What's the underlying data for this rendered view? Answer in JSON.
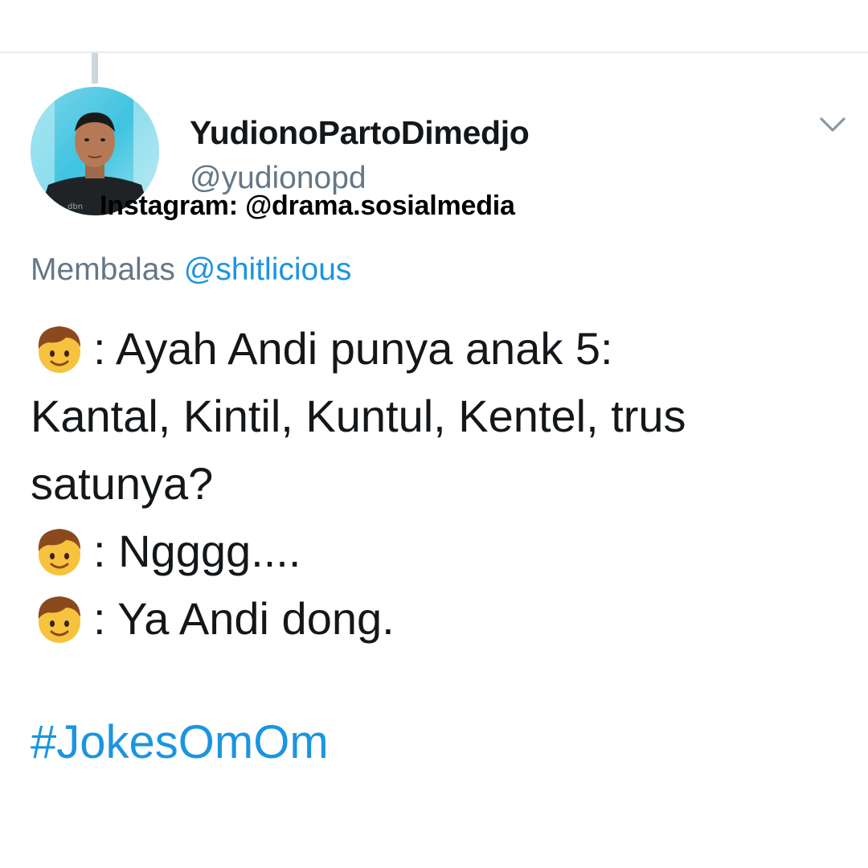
{
  "author": {
    "display_name": "YudionoPartoDimedjo",
    "handle": "@yudionopd"
  },
  "watermark": "Instagram: @drama.sosialmedia",
  "reply": {
    "prefix": "Membalas",
    "target": "@shitlicious"
  },
  "tweet": {
    "lines": [
      ": Ayah Andi punya anak 5:",
      "Kantal, Kintil, Kuntul, Kentel, trus",
      "satunya?",
      ": Ngggg....",
      ": Ya Andi dong."
    ],
    "emoji": "boy-emoji",
    "hashtag": "#JokesOmOm"
  },
  "icons": {
    "menu": "chevron-down-icon"
  },
  "colors": {
    "link": "#1b95e0",
    "secondary_text": "#657786",
    "primary_text": "#14171a",
    "divider": "#e6ecf0"
  }
}
